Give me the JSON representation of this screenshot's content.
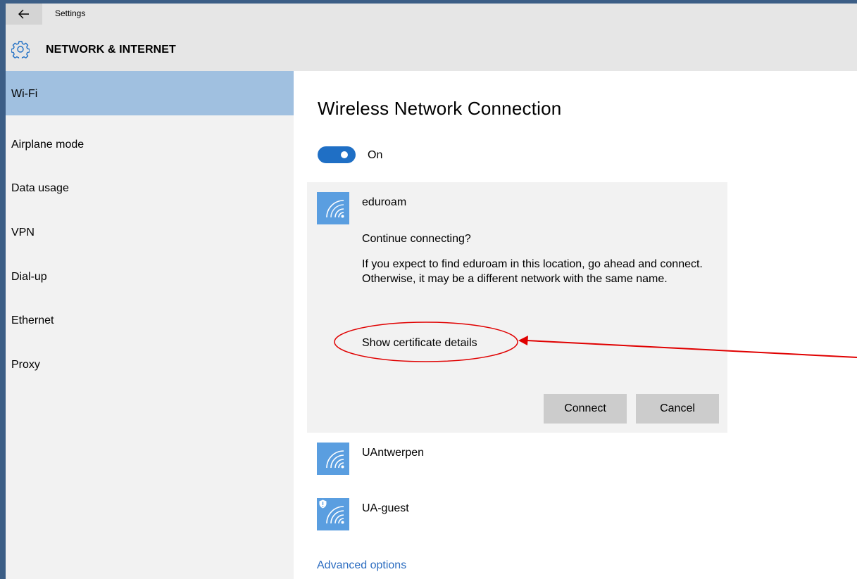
{
  "window": {
    "title": "Settings",
    "back_icon": "arrow-left-icon"
  },
  "header": {
    "icon": "gear-icon",
    "heading": "NETWORK & INTERNET"
  },
  "sidebar": {
    "items": [
      {
        "label": "Wi-Fi",
        "active": true
      },
      {
        "label": "Airplane mode",
        "active": false
      },
      {
        "label": "Data usage",
        "active": false
      },
      {
        "label": "VPN",
        "active": false
      },
      {
        "label": "Dial-up",
        "active": false
      },
      {
        "label": "Ethernet",
        "active": false
      },
      {
        "label": "Proxy",
        "active": false
      }
    ]
  },
  "main": {
    "title": "Wireless Network Connection",
    "toggle": {
      "label": "On",
      "state": "on"
    },
    "expanded_network": {
      "name": "eduroam",
      "icon": "wifi-signal-icon",
      "question": "Continue connecting?",
      "description": "If you expect to find eduroam in this location, go ahead and connect. Otherwise, it may be a different network with the same name.",
      "cert_link": "Show certificate details",
      "connect_label": "Connect",
      "cancel_label": "Cancel"
    },
    "networks": [
      {
        "name": "UAntwerpen",
        "icon": "wifi-signal-icon",
        "secured_warning": false
      },
      {
        "name": "UA-guest",
        "icon": "wifi-signal-icon",
        "secured_warning": true
      }
    ],
    "advanced_link": "Advanced options"
  },
  "colors": {
    "accent": "#1f6fc5",
    "sidebar_active": "#a0c0e0",
    "tile": "#5a9ee0",
    "annotation": "#e00000",
    "link": "#2b6cc0"
  }
}
